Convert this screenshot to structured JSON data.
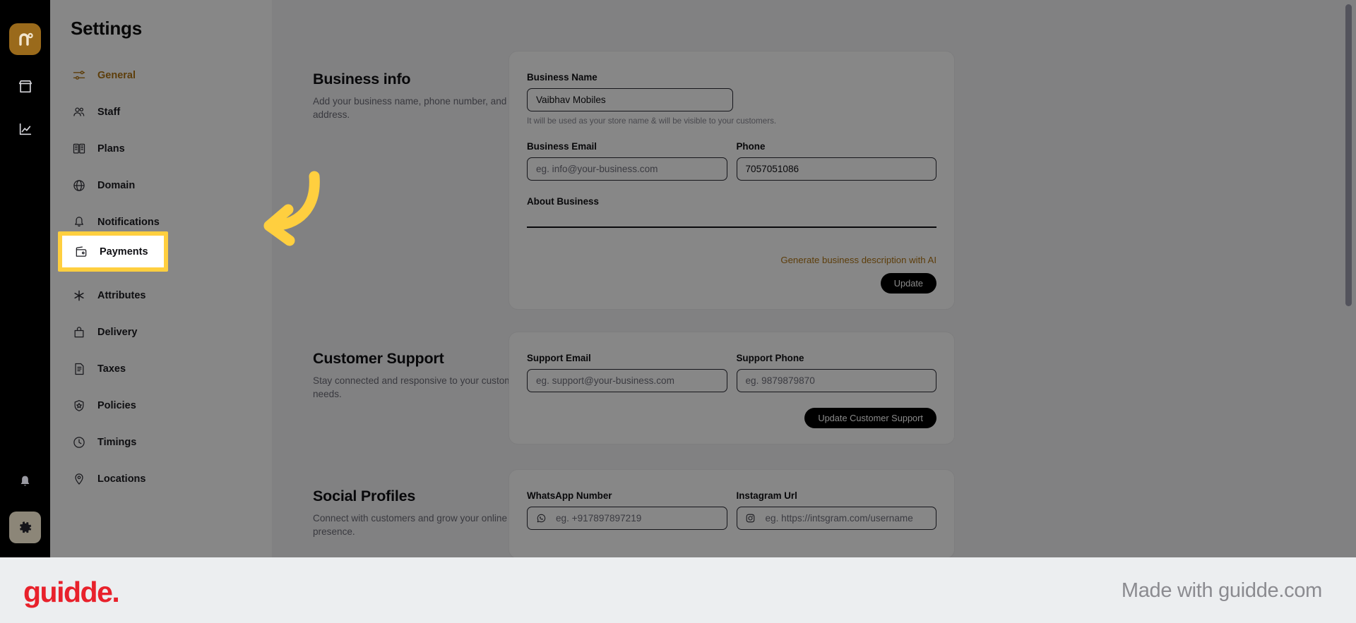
{
  "rail": {
    "logo_icon": "nowgo-logo-icon",
    "items": [
      {
        "icon": "store-icon",
        "name": "store"
      },
      {
        "icon": "analytics-chart-icon",
        "name": "analytics"
      },
      {
        "icon": "bell-icon",
        "name": "notifications"
      },
      {
        "icon": "gear-icon",
        "name": "settings"
      }
    ]
  },
  "sidebar": {
    "title": "Settings",
    "items": [
      {
        "label": "General",
        "icon": "sliders-icon",
        "active": true
      },
      {
        "label": "Staff",
        "icon": "users-icon",
        "active": false
      },
      {
        "label": "Plans",
        "icon": "plans-book-icon",
        "active": false
      },
      {
        "label": "Domain",
        "icon": "globe-icon",
        "active": false
      },
      {
        "label": "Notifications",
        "icon": "bell-icon",
        "active": false
      },
      {
        "label": "Payments",
        "icon": "wallet-icon",
        "active": false,
        "highlighted": true
      },
      {
        "label": "Attributes",
        "icon": "asterisk-icon",
        "active": false
      },
      {
        "label": "Delivery",
        "icon": "bag-icon",
        "active": false
      },
      {
        "label": "Taxes",
        "icon": "tax-document-icon",
        "active": false
      },
      {
        "label": "Policies",
        "icon": "shield-star-icon",
        "active": false
      },
      {
        "label": "Timings",
        "icon": "clock-icon",
        "active": false
      },
      {
        "label": "Locations",
        "icon": "location-pin-icon",
        "active": false
      }
    ]
  },
  "business_info": {
    "title": "Business info",
    "description": "Add your business name, phone number, and email address.",
    "business_name_label": "Business Name",
    "business_name_value": "Vaibhav Mobiles",
    "business_name_helper": "It will be used as your store name & will be visible to your customers.",
    "business_email_label": "Business Email",
    "business_email_placeholder": "eg. info@your-business.com",
    "phone_label": "Phone",
    "phone_value": "7057051086",
    "about_label": "About Business",
    "about_value": "",
    "generate_ai_link": "Generate business description with AI",
    "update_button": "Update"
  },
  "customer_support": {
    "title": "Customer Support",
    "description": "Stay connected and responsive to your customer's needs.",
    "support_email_label": "Support Email",
    "support_email_placeholder": "eg. support@your-business.com",
    "support_phone_label": "Support Phone",
    "support_phone_placeholder": "eg. 9879879870",
    "update_button": "Update Customer Support"
  },
  "social_profiles": {
    "title": "Social Profiles",
    "description": "Connect with customers and grow your online presence.",
    "whatsapp_label": "WhatsApp Number",
    "whatsapp_placeholder": "eg. +917897897219",
    "whatsapp_icon": "whatsapp-icon",
    "instagram_label": "Instagram Url",
    "instagram_placeholder": "eg. https://intsgram.com/username",
    "instagram_icon": "instagram-icon"
  },
  "footer": {
    "logo_text": "guidde.",
    "made_with": "Made with guidde.com"
  },
  "colors": {
    "accent": "#b07515",
    "highlight": "#ffcf3f",
    "rail_bg": "#000000",
    "brand_red": "#e8212b",
    "button_dark": "#000000"
  }
}
